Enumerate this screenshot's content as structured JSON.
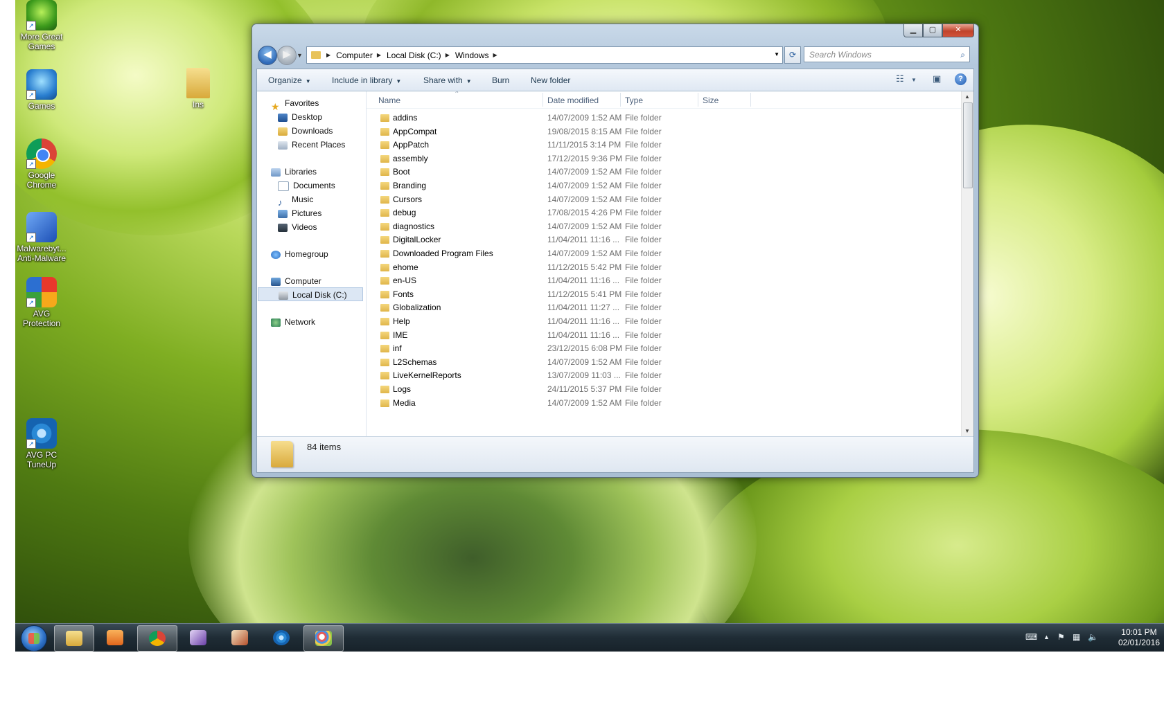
{
  "desktop": {
    "icons": [
      {
        "label": "More Great\nGames",
        "icon": "game-frog-icon"
      },
      {
        "label": "Games",
        "icon": "bigfish-games-icon"
      },
      {
        "label": "Google\nChrome",
        "icon": "chrome-icon"
      },
      {
        "label": "Malwarebyt...\nAnti-Malware",
        "icon": "malwarebytes-icon"
      },
      {
        "label": "AVG\nProtection",
        "icon": "avg-protection-icon"
      },
      {
        "label": "AVG PC\nTuneUp",
        "icon": "avg-tuneup-icon"
      },
      {
        "label": "Ins",
        "icon": "folder-icon"
      }
    ]
  },
  "explorer": {
    "window_buttons": {
      "minimize": "▁",
      "maximize": "▢",
      "close": "✕"
    },
    "address": {
      "crumbs": [
        "Computer",
        "Local Disk (C:)",
        "Windows"
      ]
    },
    "search": {
      "placeholder": "Search Windows"
    },
    "toolbar": {
      "organize": "Organize",
      "include": "Include in library",
      "share": "Share with",
      "burn": "Burn",
      "new_folder": "New folder",
      "help": "?"
    },
    "nav": {
      "favorites": "Favorites",
      "desktop": "Desktop",
      "downloads": "Downloads",
      "recent": "Recent Places",
      "libraries": "Libraries",
      "documents": "Documents",
      "music": "Music",
      "pictures": "Pictures",
      "videos": "Videos",
      "homegroup": "Homegroup",
      "computer": "Computer",
      "localdisk": "Local Disk (C:)",
      "network": "Network"
    },
    "columns": {
      "name": "Name",
      "date": "Date modified",
      "type": "Type",
      "size": "Size"
    },
    "files": [
      {
        "name": "addins",
        "date": "14/07/2009 1:52 AM",
        "type": "File folder"
      },
      {
        "name": "AppCompat",
        "date": "19/08/2015 8:15 AM",
        "type": "File folder"
      },
      {
        "name": "AppPatch",
        "date": "11/11/2015 3:14 PM",
        "type": "File folder"
      },
      {
        "name": "assembly",
        "date": "17/12/2015 9:36 PM",
        "type": "File folder"
      },
      {
        "name": "Boot",
        "date": "14/07/2009 1:52 AM",
        "type": "File folder"
      },
      {
        "name": "Branding",
        "date": "14/07/2009 1:52 AM",
        "type": "File folder"
      },
      {
        "name": "Cursors",
        "date": "14/07/2009 1:52 AM",
        "type": "File folder"
      },
      {
        "name": "debug",
        "date": "17/08/2015 4:26 PM",
        "type": "File folder"
      },
      {
        "name": "diagnostics",
        "date": "14/07/2009 1:52 AM",
        "type": "File folder"
      },
      {
        "name": "DigitalLocker",
        "date": "11/04/2011 11:16 ...",
        "type": "File folder"
      },
      {
        "name": "Downloaded Program Files",
        "date": "14/07/2009 1:52 AM",
        "type": "File folder"
      },
      {
        "name": "ehome",
        "date": "11/12/2015 5:42 PM",
        "type": "File folder"
      },
      {
        "name": "en-US",
        "date": "11/04/2011 11:16 ...",
        "type": "File folder"
      },
      {
        "name": "Fonts",
        "date": "11/12/2015 5:41 PM",
        "type": "File folder"
      },
      {
        "name": "Globalization",
        "date": "11/04/2011 11:27 ...",
        "type": "File folder"
      },
      {
        "name": "Help",
        "date": "11/04/2011 11:16 ...",
        "type": "File folder"
      },
      {
        "name": "IME",
        "date": "11/04/2011 11:16 ...",
        "type": "File folder"
      },
      {
        "name": "inf",
        "date": "23/12/2015 6:08 PM",
        "type": "File folder"
      },
      {
        "name": "L2Schemas",
        "date": "14/07/2009 1:52 AM",
        "type": "File folder"
      },
      {
        "name": "LiveKernelReports",
        "date": "13/07/2009 11:03 ...",
        "type": "File folder"
      },
      {
        "name": "Logs",
        "date": "24/11/2015 5:37 PM",
        "type": "File folder"
      },
      {
        "name": "Media",
        "date": "14/07/2009 1:52 AM",
        "type": "File folder"
      }
    ],
    "status": {
      "count": "84 items"
    }
  },
  "taskbar": {
    "apps": [
      "file-explorer-icon",
      "media-player-icon",
      "chrome-icon",
      "app-purple-icon",
      "app-card-icon",
      "avg-tuneup-icon",
      "paint-icon"
    ],
    "clock": {
      "time": "10:01 PM",
      "date": "02/01/2016"
    }
  },
  "colors": {
    "accent": "#2f6ab8",
    "selection": "#dce7f4",
    "folder": "#e8c35a"
  }
}
